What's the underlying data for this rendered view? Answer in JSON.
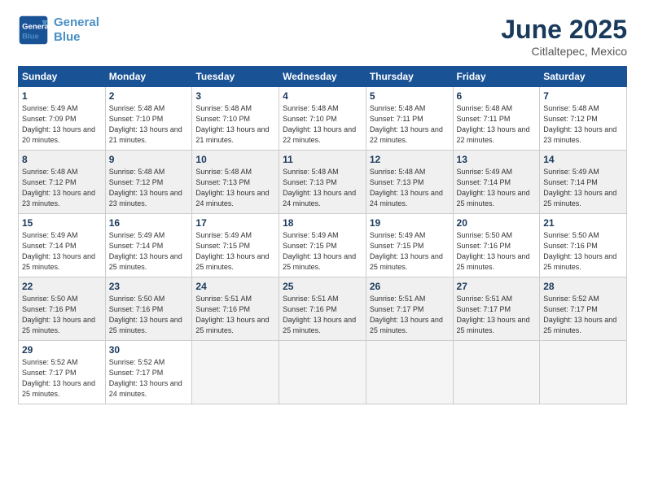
{
  "header": {
    "logo_line1": "General",
    "logo_line2": "Blue",
    "month": "June 2025",
    "location": "Citlaltepec, Mexico"
  },
  "weekdays": [
    "Sunday",
    "Monday",
    "Tuesday",
    "Wednesday",
    "Thursday",
    "Friday",
    "Saturday"
  ],
  "rows": [
    [
      {
        "day": "1",
        "sunrise": "Sunrise: 5:49 AM",
        "sunset": "Sunset: 7:09 PM",
        "daylight": "Daylight: 13 hours and 20 minutes."
      },
      {
        "day": "2",
        "sunrise": "Sunrise: 5:48 AM",
        "sunset": "Sunset: 7:10 PM",
        "daylight": "Daylight: 13 hours and 21 minutes."
      },
      {
        "day": "3",
        "sunrise": "Sunrise: 5:48 AM",
        "sunset": "Sunset: 7:10 PM",
        "daylight": "Daylight: 13 hours and 21 minutes."
      },
      {
        "day": "4",
        "sunrise": "Sunrise: 5:48 AM",
        "sunset": "Sunset: 7:10 PM",
        "daylight": "Daylight: 13 hours and 22 minutes."
      },
      {
        "day": "5",
        "sunrise": "Sunrise: 5:48 AM",
        "sunset": "Sunset: 7:11 PM",
        "daylight": "Daylight: 13 hours and 22 minutes."
      },
      {
        "day": "6",
        "sunrise": "Sunrise: 5:48 AM",
        "sunset": "Sunset: 7:11 PM",
        "daylight": "Daylight: 13 hours and 22 minutes."
      },
      {
        "day": "7",
        "sunrise": "Sunrise: 5:48 AM",
        "sunset": "Sunset: 7:12 PM",
        "daylight": "Daylight: 13 hours and 23 minutes."
      }
    ],
    [
      {
        "day": "8",
        "sunrise": "Sunrise: 5:48 AM",
        "sunset": "Sunset: 7:12 PM",
        "daylight": "Daylight: 13 hours and 23 minutes."
      },
      {
        "day": "9",
        "sunrise": "Sunrise: 5:48 AM",
        "sunset": "Sunset: 7:12 PM",
        "daylight": "Daylight: 13 hours and 23 minutes."
      },
      {
        "day": "10",
        "sunrise": "Sunrise: 5:48 AM",
        "sunset": "Sunset: 7:13 PM",
        "daylight": "Daylight: 13 hours and 24 minutes."
      },
      {
        "day": "11",
        "sunrise": "Sunrise: 5:48 AM",
        "sunset": "Sunset: 7:13 PM",
        "daylight": "Daylight: 13 hours and 24 minutes."
      },
      {
        "day": "12",
        "sunrise": "Sunrise: 5:48 AM",
        "sunset": "Sunset: 7:13 PM",
        "daylight": "Daylight: 13 hours and 24 minutes."
      },
      {
        "day": "13",
        "sunrise": "Sunrise: 5:49 AM",
        "sunset": "Sunset: 7:14 PM",
        "daylight": "Daylight: 13 hours and 25 minutes."
      },
      {
        "day": "14",
        "sunrise": "Sunrise: 5:49 AM",
        "sunset": "Sunset: 7:14 PM",
        "daylight": "Daylight: 13 hours and 25 minutes."
      }
    ],
    [
      {
        "day": "15",
        "sunrise": "Sunrise: 5:49 AM",
        "sunset": "Sunset: 7:14 PM",
        "daylight": "Daylight: 13 hours and 25 minutes."
      },
      {
        "day": "16",
        "sunrise": "Sunrise: 5:49 AM",
        "sunset": "Sunset: 7:14 PM",
        "daylight": "Daylight: 13 hours and 25 minutes."
      },
      {
        "day": "17",
        "sunrise": "Sunrise: 5:49 AM",
        "sunset": "Sunset: 7:15 PM",
        "daylight": "Daylight: 13 hours and 25 minutes."
      },
      {
        "day": "18",
        "sunrise": "Sunrise: 5:49 AM",
        "sunset": "Sunset: 7:15 PM",
        "daylight": "Daylight: 13 hours and 25 minutes."
      },
      {
        "day": "19",
        "sunrise": "Sunrise: 5:49 AM",
        "sunset": "Sunset: 7:15 PM",
        "daylight": "Daylight: 13 hours and 25 minutes."
      },
      {
        "day": "20",
        "sunrise": "Sunrise: 5:50 AM",
        "sunset": "Sunset: 7:16 PM",
        "daylight": "Daylight: 13 hours and 25 minutes."
      },
      {
        "day": "21",
        "sunrise": "Sunrise: 5:50 AM",
        "sunset": "Sunset: 7:16 PM",
        "daylight": "Daylight: 13 hours and 25 minutes."
      }
    ],
    [
      {
        "day": "22",
        "sunrise": "Sunrise: 5:50 AM",
        "sunset": "Sunset: 7:16 PM",
        "daylight": "Daylight: 13 hours and 25 minutes."
      },
      {
        "day": "23",
        "sunrise": "Sunrise: 5:50 AM",
        "sunset": "Sunset: 7:16 PM",
        "daylight": "Daylight: 13 hours and 25 minutes."
      },
      {
        "day": "24",
        "sunrise": "Sunrise: 5:51 AM",
        "sunset": "Sunset: 7:16 PM",
        "daylight": "Daylight: 13 hours and 25 minutes."
      },
      {
        "day": "25",
        "sunrise": "Sunrise: 5:51 AM",
        "sunset": "Sunset: 7:16 PM",
        "daylight": "Daylight: 13 hours and 25 minutes."
      },
      {
        "day": "26",
        "sunrise": "Sunrise: 5:51 AM",
        "sunset": "Sunset: 7:17 PM",
        "daylight": "Daylight: 13 hours and 25 minutes."
      },
      {
        "day": "27",
        "sunrise": "Sunrise: 5:51 AM",
        "sunset": "Sunset: 7:17 PM",
        "daylight": "Daylight: 13 hours and 25 minutes."
      },
      {
        "day": "28",
        "sunrise": "Sunrise: 5:52 AM",
        "sunset": "Sunset: 7:17 PM",
        "daylight": "Daylight: 13 hours and 25 minutes."
      }
    ],
    [
      {
        "day": "29",
        "sunrise": "Sunrise: 5:52 AM",
        "sunset": "Sunset: 7:17 PM",
        "daylight": "Daylight: 13 hours and 25 minutes."
      },
      {
        "day": "30",
        "sunrise": "Sunrise: 5:52 AM",
        "sunset": "Sunset: 7:17 PM",
        "daylight": "Daylight: 13 hours and 24 minutes."
      },
      null,
      null,
      null,
      null,
      null
    ]
  ]
}
